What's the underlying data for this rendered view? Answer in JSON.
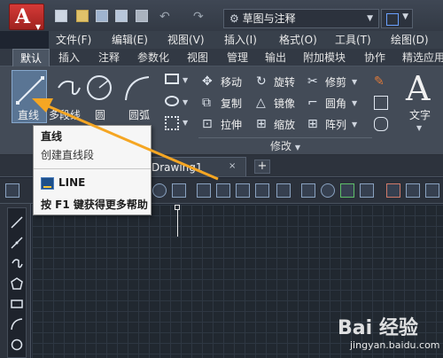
{
  "title_bar": {
    "app_button": "A",
    "workspace": "草图与注释",
    "quick_access_icons": [
      "new-file-icon",
      "open-folder-icon",
      "save-icon",
      "save-as-icon",
      "print-icon",
      "undo-icon",
      "redo-icon",
      "gear-icon"
    ]
  },
  "menu": {
    "items": [
      "文件(F)",
      "编辑(E)",
      "视图(V)",
      "插入(I)",
      "格式(O)",
      "工具(T)",
      "绘图(D)"
    ]
  },
  "ribbon": {
    "tabs": [
      "默认",
      "插入",
      "注释",
      "参数化",
      "视图",
      "管理",
      "输出",
      "附加模块",
      "协作",
      "精选应用"
    ],
    "draw_tools": [
      "直线",
      "多段线",
      "圆",
      "圆弧"
    ],
    "modify_tools": [
      "移动",
      "旋转",
      "修剪",
      "复制",
      "镜像",
      "圆角",
      "拉伸",
      "缩放",
      "阵列"
    ],
    "modify_panel_title": "修改",
    "text_tool": "文字"
  },
  "doc_tab": {
    "label": "Drawing1",
    "close": "×",
    "new_tab": "+"
  },
  "tooltip": {
    "title": "直线",
    "description": "创建直线段",
    "command": "LINE",
    "help": "按 F1 键获得更多帮助"
  },
  "watermark": {
    "logo": "Bai 经验",
    "site": "jingyan.baidu.com"
  },
  "colors": {
    "accent_red": "#c0302d",
    "ribbon_bg": "#434b57",
    "canvas_bg": "#212830",
    "arrow": "#f5a623"
  }
}
